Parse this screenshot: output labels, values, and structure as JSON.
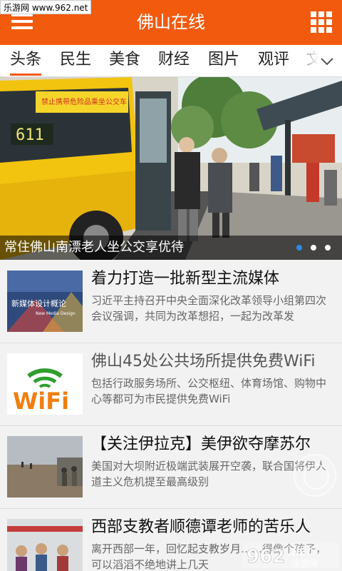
{
  "watermark_top": "乐游网 www.962.net",
  "header": {
    "title": "佛山在线",
    "menu_icon": "menu-icon",
    "grid_icon": "grid-icon",
    "color": "#f25a0e"
  },
  "tabs": [
    {
      "label": "头条",
      "active": true
    },
    {
      "label": "民生"
    },
    {
      "label": "美食"
    },
    {
      "label": "财经"
    },
    {
      "label": "图片"
    },
    {
      "label": "观评"
    },
    {
      "label": "文"
    }
  ],
  "hero": {
    "caption": "常住佛山南漂老人坐公交享优待",
    "bus_number": "611",
    "bus_sign": "禁止携带危险品乘坐公交车",
    "slides": 3,
    "active_slide": 0
  },
  "news": [
    {
      "title": "着力打造一批新型主流媒体",
      "desc": "习近平主持召开中央全面深化改革领导小组第四次会议强调，共同为改革想招，一起为改革发",
      "thumb": {
        "cover_title": "新媒体设计概论",
        "cover_subtitle": "New Media Design"
      }
    },
    {
      "title": "佛山45处公共场所提供免费WiFi",
      "desc": "包括行政服务场所、公交枢纽、体育场馆、购物中心等都可为市民提供免费WiFi",
      "thumb": {
        "logo_text": "WiFi"
      },
      "faded": true
    },
    {
      "title": "【关注伊拉克】美伊欲夺摩苏尔",
      "desc": "美国对大坝附近极端武装展开空袭，联合国将伊人道主义危机提至最高级别",
      "thumb": {}
    },
    {
      "title": "西部支教者顺德谭老师的苦乐人",
      "desc": "离开西部一年，回忆起支教岁月……得像个孩子，可以滔滔不绝地讲上几天",
      "thumb": {}
    }
  ],
  "watermark_bottom": {
    "brand": "962",
    "domain": ".NET",
    "sub": "乐游网"
  }
}
